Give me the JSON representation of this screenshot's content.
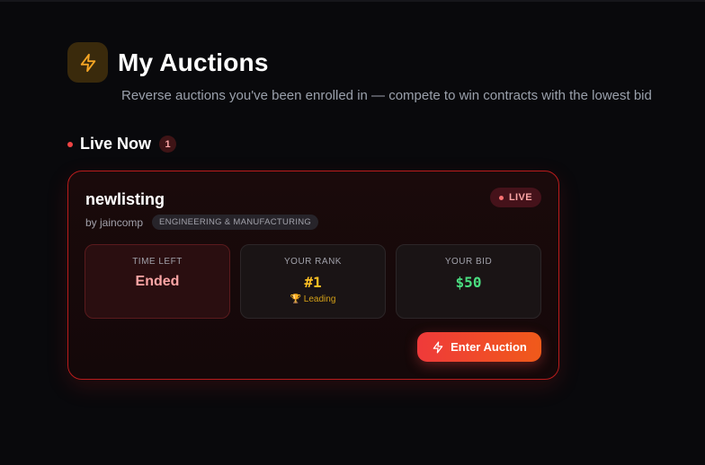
{
  "header": {
    "icon": "bolt-icon",
    "title": "My Auctions",
    "subtitle": "Reverse auctions you've been enrolled in — compete to win contracts with the lowest bid"
  },
  "live_section": {
    "title": "Live Now",
    "count": "1"
  },
  "auction": {
    "name": "newlisting",
    "by": "by jaincomp",
    "category": "ENGINEERING & MANUFACTURING",
    "status": "LIVE",
    "time_left_label": "TIME LEFT",
    "time_left_value": "Ended",
    "rank_label": "YOUR RANK",
    "rank_value": "#1",
    "rank_sub": "🏆 Leading",
    "bid_label": "YOUR BID",
    "bid_value": "$50",
    "enter_label": "Enter Auction"
  },
  "colors": {
    "accent_red": "#ef4444",
    "gold": "#fbbf24",
    "green": "#4ade80",
    "background": "#09090c"
  }
}
